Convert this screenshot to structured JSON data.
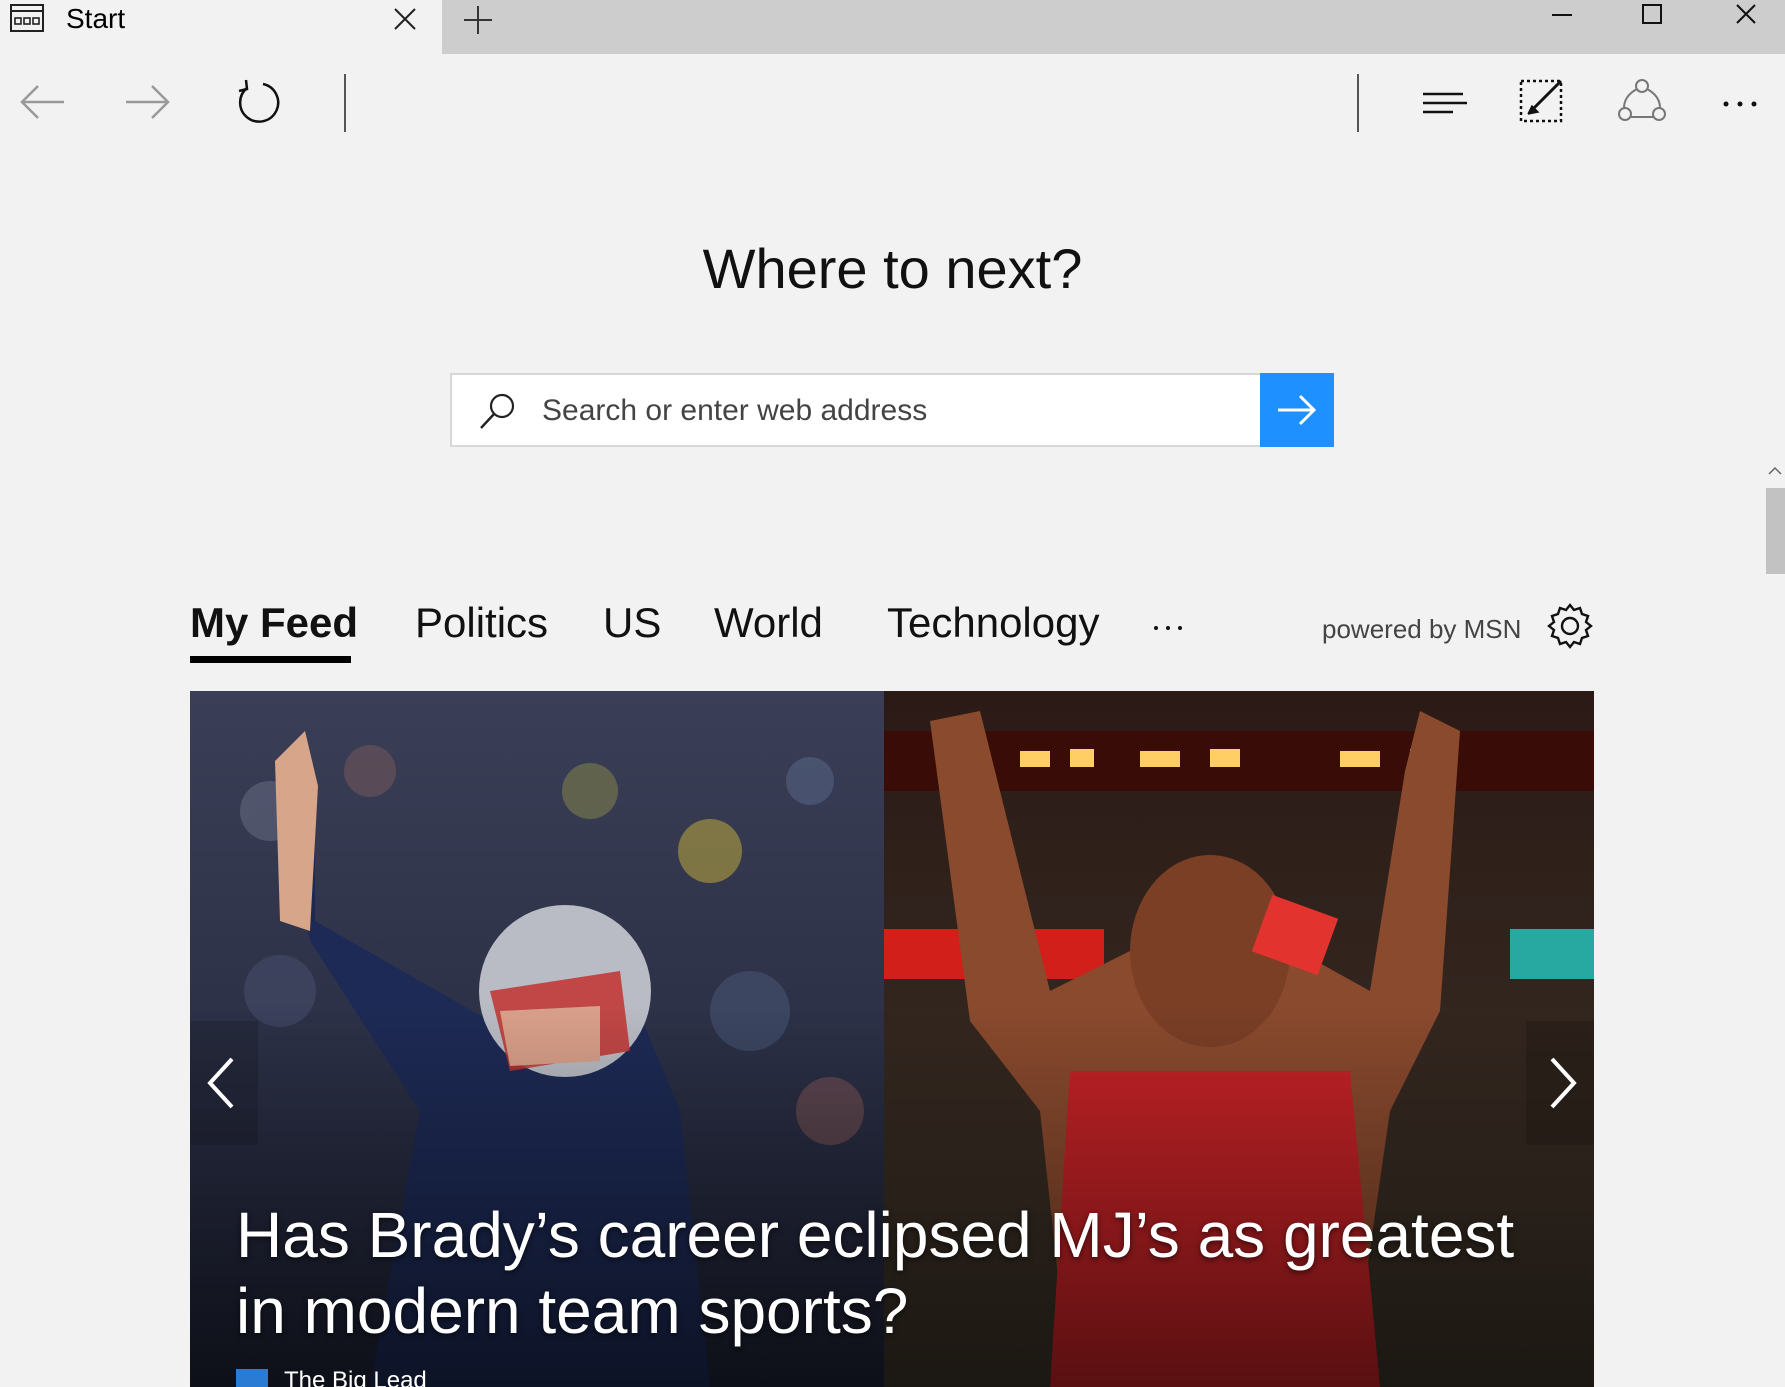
{
  "tab": {
    "title": "Start",
    "icon": "start-page-icon"
  },
  "window_controls": [
    "minimize-icon",
    "maximize-icon",
    "close-icon"
  ],
  "nav": {
    "back_icon": "back-arrow-icon",
    "forward_icon": "forward-arrow-icon",
    "refresh_icon": "refresh-icon"
  },
  "toolbar": {
    "hub_icon": "hub-icon",
    "note_icon": "web-note-icon",
    "share_icon": "share-icon",
    "more_icon": "more-ellipsis-icon"
  },
  "main": {
    "heading": "Where to next?",
    "search": {
      "placeholder": "Search or enter web address",
      "value": ""
    },
    "go_button_color": "#1e90ff"
  },
  "feed": {
    "tabs": [
      {
        "label": "My Feed",
        "active": true
      },
      {
        "label": "Politics",
        "active": false
      },
      {
        "label": "US",
        "active": false
      },
      {
        "label": "World",
        "active": false
      },
      {
        "label": "Technology",
        "active": false
      }
    ],
    "more_label": "···",
    "powered_by": "powered by MSN"
  },
  "hero": {
    "headline": "Has Brady’s career eclipsed MJ’s as greatest in modern team sports?",
    "source": "The Big Lead"
  }
}
